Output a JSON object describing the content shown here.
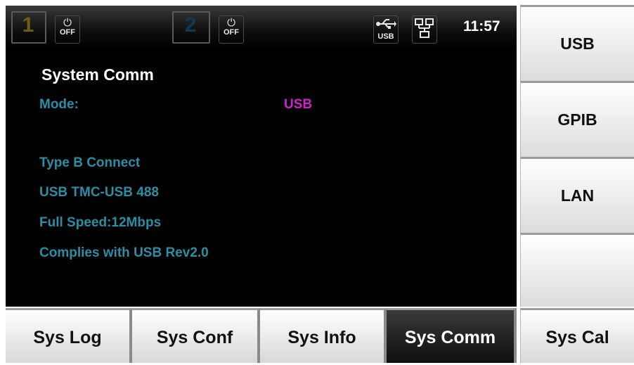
{
  "status": {
    "channel1": {
      "number": "1",
      "power_label": "OFF"
    },
    "channel2": {
      "number": "2",
      "power_label": "OFF"
    },
    "usb_label": "USB",
    "time": "11:57"
  },
  "content": {
    "title": "System Comm",
    "mode_label": "Mode:",
    "mode_value": "USB",
    "info_lines": [
      "Type B Connect",
      "USB TMC-USB 488",
      "Full Speed:12Mbps",
      "Complies with USB Rev2.0"
    ]
  },
  "softkeys": [
    "USB",
    "GPIB",
    "LAN",
    ""
  ],
  "tabs": [
    "Sys Log",
    "Sys Conf",
    "Sys Info",
    "Sys Comm",
    "Sys Cal"
  ],
  "active_tab": "Sys Comm",
  "colors": {
    "info_text": "#2a8fa5",
    "mode_value": "#d020d0",
    "screen_bg": "#000000",
    "ch1": "#6d5e12",
    "ch2": "#0f3a55"
  },
  "icons": [
    "power-icon",
    "usb-icon",
    "lan-icon"
  ]
}
